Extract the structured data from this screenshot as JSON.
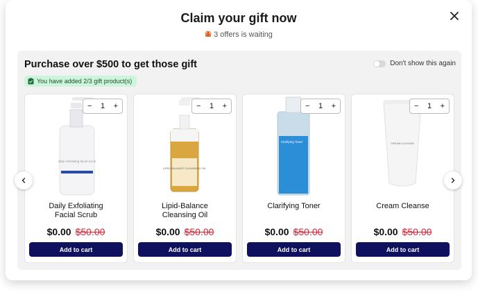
{
  "modal": {
    "title": "Claim your gift now",
    "subtitle": "3 offers is waiting",
    "subtitle_icon": "gift-icon"
  },
  "panel": {
    "heading": "Purchase over $500 to get those gift",
    "dont_show_label": "Don't show this again",
    "badge_text": "You have added 2/3 gift product(s)"
  },
  "products": [
    {
      "name_line1": "Daily Exfoliating",
      "name_line2": "Facial Scrub",
      "qty": "1",
      "price": "$0.00",
      "old_price": "$50.00",
      "cta": "Add to cart",
      "bottle_label": "daily exfoliating facial scrub"
    },
    {
      "name_line1": "Lipid-Balance",
      "name_line2": "Cleansing Oil",
      "qty": "1",
      "price": "$0.00",
      "old_price": "$50.00",
      "cta": "Add to cart",
      "bottle_label": "LIPID-BALANCE CLEANSING OIL"
    },
    {
      "name_line1": "Clarifying Toner",
      "name_line2": "",
      "qty": "1",
      "price": "$0.00",
      "old_price": "$50.00",
      "cta": "Add to cart",
      "bottle_label": "Clarifying Toner"
    },
    {
      "name_line1": "Cream Cleanse",
      "name_line2": "",
      "qty": "1",
      "price": "$0.00",
      "old_price": "$50.00",
      "cta": "Add to cart",
      "bottle_label": "CREAM CLEANSE"
    }
  ],
  "stepper": {
    "minus": "−",
    "plus": "+"
  },
  "colors": {
    "button": "#10115e",
    "strike_price": "#dd2233",
    "badge_bg": "#cdf5dc",
    "panel_bg": "#f2f2f2"
  }
}
